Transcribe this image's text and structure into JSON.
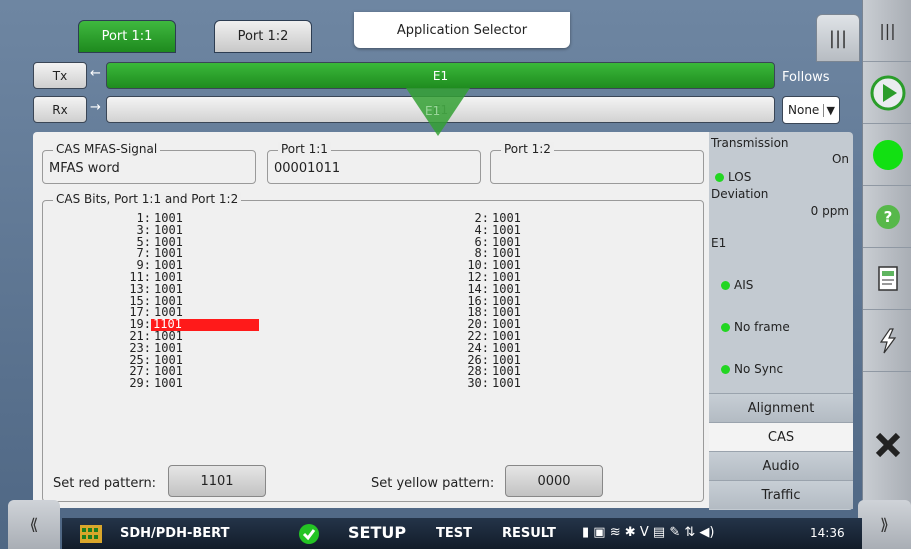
{
  "ports": {
    "active": "Port 1:1",
    "inactive": "Port 1:2"
  },
  "app_selector": "Application Selector",
  "tx": {
    "label": "Tx",
    "signal": "E1"
  },
  "rx": {
    "label": "Rx",
    "signal": "E1"
  },
  "pointer_label": "E1",
  "follows": {
    "label": "Follows",
    "value": "None"
  },
  "cas_mfas": {
    "legend": "CAS MFAS-Signal",
    "value": "MFAS word"
  },
  "port11": {
    "legend": "Port 1:1",
    "value": "00001011"
  },
  "port12": {
    "legend": "Port 1:2",
    "value": ""
  },
  "cas_bits": {
    "legend": "CAS Bits, Port 1:1 and Port 1:2",
    "left": [
      {
        "n": "1:",
        "v": "1001"
      },
      {
        "n": "3:",
        "v": "1001"
      },
      {
        "n": "5:",
        "v": "1001"
      },
      {
        "n": "7:",
        "v": "1001"
      },
      {
        "n": "9:",
        "v": "1001"
      },
      {
        "n": "11:",
        "v": "1001"
      },
      {
        "n": "13:",
        "v": "1001"
      },
      {
        "n": "15:",
        "v": "1001"
      },
      {
        "n": "17:",
        "v": "1001"
      },
      {
        "n": "19:",
        "v": "1101"
      },
      {
        "n": "21:",
        "v": "1001"
      },
      {
        "n": "23:",
        "v": "1001"
      },
      {
        "n": "25:",
        "v": "1001"
      },
      {
        "n": "27:",
        "v": "1001"
      },
      {
        "n": "29:",
        "v": "1001"
      }
    ],
    "right": [
      {
        "n": "2:",
        "v": "1001"
      },
      {
        "n": "4:",
        "v": "1001"
      },
      {
        "n": "6:",
        "v": "1001"
      },
      {
        "n": "8:",
        "v": "1001"
      },
      {
        "n": "10:",
        "v": "1001"
      },
      {
        "n": "12:",
        "v": "1001"
      },
      {
        "n": "14:",
        "v": "1001"
      },
      {
        "n": "16:",
        "v": "1001"
      },
      {
        "n": "18:",
        "v": "1001"
      },
      {
        "n": "20:",
        "v": "1001"
      },
      {
        "n": "22:",
        "v": "1001"
      },
      {
        "n": "24:",
        "v": "1001"
      },
      {
        "n": "26:",
        "v": "1001"
      },
      {
        "n": "28:",
        "v": "1001"
      },
      {
        "n": "30:",
        "v": "1001"
      }
    ],
    "highlight_color": "#ff1a1a"
  },
  "patterns": {
    "red_label": "Set red pattern:",
    "red_value": "1101",
    "yellow_label": "Set yellow pattern:",
    "yellow_value": "0000"
  },
  "status": {
    "transmission_label": "Transmission",
    "transmission_value": "On",
    "los": "LOS",
    "deviation_label": "Deviation",
    "deviation_value": "0 ppm",
    "e1_label": "E1",
    "ais": "AIS",
    "no_frame": "No frame",
    "no_sync": "No Sync",
    "indicator_color": "#22d622"
  },
  "side_tabs": [
    "Alignment",
    "CAS",
    "Audio",
    "Traffic"
  ],
  "side_tab_active": "CAS",
  "bottom": {
    "app_name": "SDH/PDH-BERT",
    "setup": "SETUP",
    "test": "TEST",
    "result": "RESULT",
    "time": "14:36"
  },
  "icons": {
    "menu": "menu-icon",
    "play": "play-icon",
    "status_led": "status-led-icon",
    "help": "help-icon",
    "report": "report-icon",
    "error_inject": "lightning-icon",
    "close": "close-icon",
    "nav_left": "chevron-left-icon",
    "nav_right": "chevron-right-icon"
  }
}
